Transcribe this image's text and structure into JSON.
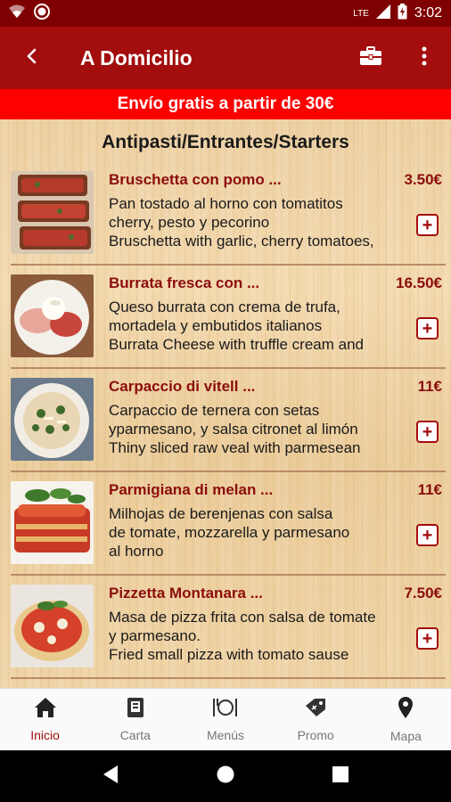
{
  "status_bar": {
    "time": "3:02",
    "network": "LTE"
  },
  "app_bar": {
    "title": "A Domicilio",
    "back_icon": "arrow-back-icon",
    "bag_icon": "briefcase-icon",
    "menu_icon": "more-vert-icon"
  },
  "promo": {
    "text": "Envío gratis a partir de 30€"
  },
  "section": {
    "title": "Antipasti/Entrantes/Starters"
  },
  "dishes": [
    {
      "name": "Bruschetta con pomo ...",
      "price": "3.50€",
      "desc": [
        "Pan tostado al horno con tomatitos",
        "cherry, pesto y pecorino",
        "Bruschetta with garlic, cherry tomatoes,"
      ],
      "add": "+"
    },
    {
      "name": "Burrata fresca con  ...",
      "price": "16.50€",
      "desc": [
        "Queso burrata con crema de trufa,",
        "mortadela y embutidos italianos",
        "Burrata Cheese with truffle cream and"
      ],
      "add": "+"
    },
    {
      "name": "Carpaccio di vitell ...",
      "price": "11€",
      "desc": [
        "Carpaccio de ternera con setas",
        "yparmesano, y salsa citronet al limón",
        "Thiny sliced raw veal with parmesean"
      ],
      "add": "+"
    },
    {
      "name": "Parmigiana di melan ...",
      "price": "11€",
      "desc": [
        "Milhojas de berenjenas con salsa",
        "de tomate, mozzarella y parmesano",
        "al horno"
      ],
      "add": "+"
    },
    {
      "name": "Pizzetta Montanara  ...",
      "price": "7.50€",
      "desc": [
        "Masa de pizza frita con salsa de tomate",
        "y parmesano.",
        "Fried  small pizza with tomato sause"
      ],
      "add": "+"
    }
  ],
  "bottom_nav": [
    {
      "label": "Inicio",
      "icon": "home-icon",
      "active": true
    },
    {
      "label": "Carta",
      "icon": "menu-book-icon",
      "active": false
    },
    {
      "label": "Menús",
      "icon": "cutlery-icon",
      "active": false
    },
    {
      "label": "Promo",
      "icon": "promo-tag-icon",
      "active": false
    },
    {
      "label": "Mapa",
      "icon": "map-pin-icon",
      "active": false
    }
  ],
  "colors": {
    "primary": "#a30d0d",
    "status": "#7f0000",
    "banner": "#ff0000",
    "accent_text": "#8b0d0d"
  }
}
